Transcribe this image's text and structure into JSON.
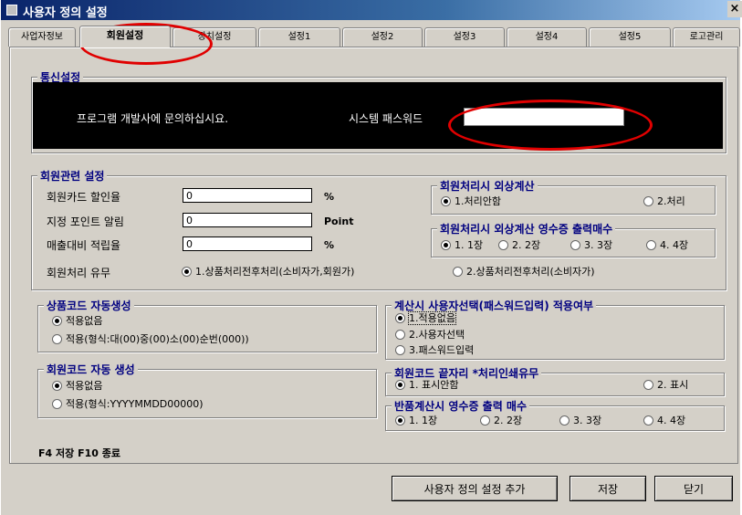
{
  "window": {
    "title": "사용자 정의 설정",
    "close_glyph": "×"
  },
  "tabs": [
    "사업자정보",
    "회원설정",
    "장치설정",
    "설정1",
    "설정2",
    "설정3",
    "설정4",
    "설정5",
    "로고관리"
  ],
  "communication": {
    "title": "통신설정",
    "message": "프로그램 개발사에 문의하십시요.",
    "password_label": "시스템 패스워드",
    "password_value": ""
  },
  "member_settings": {
    "title": "회원관련 설정",
    "card_discount": {
      "label": "회원카드 할인율",
      "value": "0",
      "unit": "%"
    },
    "branch_point_alert": {
      "label": "지정 포인트 알림",
      "value": "0",
      "unit": "Point"
    },
    "sales_accrual": {
      "label": "매출대비 적립율",
      "value": "0",
      "unit": "%"
    },
    "member_process": {
      "label": "회원처리 유무",
      "options": [
        "1.상품처리전후처리(소비자가,회원가)",
        "2.상품처리전후처리(소비자가)"
      ],
      "selected": 0
    }
  },
  "credit_calc": {
    "title": "회원처리시 외상계산",
    "options": [
      "1.처리안함",
      "2.처리"
    ],
    "selected": 0
  },
  "credit_receipt": {
    "title": "회원처리시 외상계산 영수증 출력매수",
    "options": [
      "1. 1장",
      "2. 2장",
      "3. 3장",
      "4. 4장"
    ],
    "selected": 0
  },
  "product_code": {
    "title": "상품코드 자동생성",
    "options": [
      "적용없음",
      "적용(형식:대(00)중(00)소(00)순번(000))"
    ],
    "selected": 0
  },
  "member_code": {
    "title": "회원코드 자동 생성",
    "options": [
      "적용없음",
      "적용(형식:YYYYMMDD00000)"
    ],
    "selected": 0
  },
  "calculator_user": {
    "title": "계산시 사용자선택(패스워드입력) 적용여부",
    "options": [
      "1.적용없음",
      "2.사용자선택",
      "3.패스워드입력"
    ],
    "selected": 0
  },
  "member_code_tail": {
    "title": "회원코드 끝자리 *처리인쇄유무",
    "options": [
      "1. 표시안함",
      "2. 표시"
    ],
    "selected": 0
  },
  "return_receipt": {
    "title": "반품계산시 영수증 출력 매수",
    "options": [
      "1. 1장",
      "2. 2장",
      "3. 3장",
      "4. 4장"
    ],
    "selected": 0
  },
  "hotkeys": "F4 저장   F10 종료",
  "buttons": {
    "add": "사용자 정의 설정 추가",
    "save": "저장",
    "close": "닫기"
  },
  "colors": {
    "group_title": "#000080",
    "annotation": "#e00000",
    "title_bar": "#0a246a"
  }
}
